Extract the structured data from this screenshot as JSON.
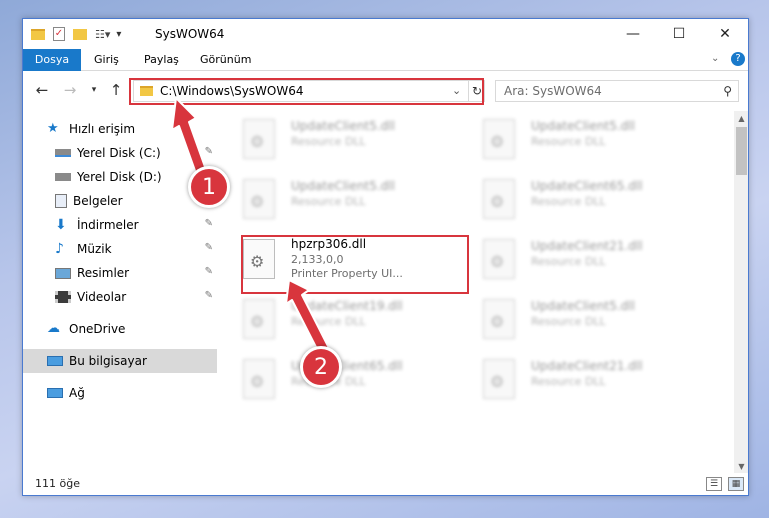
{
  "window": {
    "title": "SysWOW64"
  },
  "ribbon": {
    "tabs": [
      "Dosya",
      "Giriş",
      "Paylaş",
      "Görünüm"
    ]
  },
  "nav": {
    "address": "C:\\Windows\\SysWOW64",
    "search_placeholder": "Ara: SysWOW64"
  },
  "sidebar": {
    "items": [
      {
        "label": "Hızlı erişim",
        "icon": "star-icon"
      },
      {
        "label": "Yerel Disk (C:)",
        "icon": "drive-icon"
      },
      {
        "label": "Yerel Disk (D:)",
        "icon": "drive-icon"
      },
      {
        "label": "Belgeler",
        "icon": "documents-icon"
      },
      {
        "label": "İndirmeler",
        "icon": "download-icon"
      },
      {
        "label": "Müzik",
        "icon": "music-icon"
      },
      {
        "label": "Resimler",
        "icon": "pictures-icon"
      },
      {
        "label": "Videolar",
        "icon": "videos-icon"
      },
      {
        "label": "OneDrive",
        "icon": "cloud-icon"
      },
      {
        "label": "Bu bilgisayar",
        "icon": "computer-icon"
      },
      {
        "label": "Ağ",
        "icon": "network-icon"
      }
    ]
  },
  "files": [
    {
      "name": "UpdateClient5.dll",
      "desc": "Resource DLL"
    },
    {
      "name": "UpdateClient5.dll",
      "desc": "Resource DLL"
    },
    {
      "name": "UpdateClient5.dll",
      "desc": "Resource DLL"
    },
    {
      "name": "UpdateClient65.dll",
      "desc": "Resource DLL"
    },
    {
      "name": "hpzrp306.dll",
      "version": "2,133,0,0",
      "desc": "Printer Property UI..."
    },
    {
      "name": "UpdateClient21.dll",
      "desc": "Resource DLL"
    },
    {
      "name": "UpdateClient19.dll",
      "desc": "Resource DLL"
    },
    {
      "name": "UpdateClient5.dll",
      "desc": "Resource DLL"
    },
    {
      "name": "UpdateClient65.dll",
      "desc": "Resource DLL"
    },
    {
      "name": "UpdateClient21.dll",
      "desc": "Resource DLL"
    }
  ],
  "status": {
    "count": "111 öğe"
  },
  "annotations": {
    "step1": "1",
    "step2": "2"
  },
  "colors": {
    "accent": "#1979ca",
    "highlight": "#d8353d",
    "selected": "#d9d9d9"
  }
}
